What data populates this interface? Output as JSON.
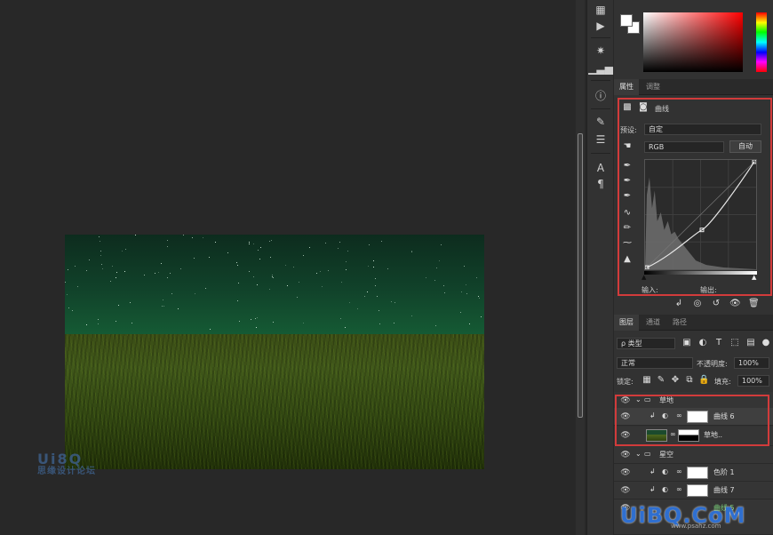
{
  "color_panel": {
    "fg": "#ffffff",
    "bg": "#ffffff",
    "field_hue": "#ff0000"
  },
  "properties": {
    "tabs": [
      "属性",
      "调整"
    ],
    "title": "曲线",
    "preset_label": "预设:",
    "preset_value": "自定",
    "channel_value": "RGB",
    "auto_label": "自动",
    "input_label": "输入:",
    "output_label": "输出:"
  },
  "layers": {
    "tabs": [
      "图层",
      "通道",
      "路径"
    ],
    "filter_value": "ρ 类型",
    "blend_mode": "正常",
    "opacity_label": "不透明度:",
    "opacity_value": "100%",
    "lock_label": "锁定:",
    "fill_label": "填充:",
    "fill_value": "100%",
    "items": [
      {
        "name": "草地",
        "kind": "group"
      },
      {
        "name": "曲线 6",
        "kind": "adjustment"
      },
      {
        "name": "草地..",
        "kind": "image"
      },
      {
        "name": "星空",
        "kind": "group"
      },
      {
        "name": "色阶 1",
        "kind": "adjustment"
      },
      {
        "name": "曲线 7",
        "kind": "adjustment"
      },
      {
        "name": "曲线 5",
        "kind": "adjustment"
      }
    ]
  },
  "watermark": {
    "brand": "UiBQ.CoM",
    "url": "www.psahz.com",
    "left_top": "Ui8Q",
    "left_bottom": "思缘设计论坛"
  },
  "colors": {
    "highlight_border": "#d23b3b",
    "panel_bg": "#323232",
    "canvas_bg": "#282828"
  }
}
